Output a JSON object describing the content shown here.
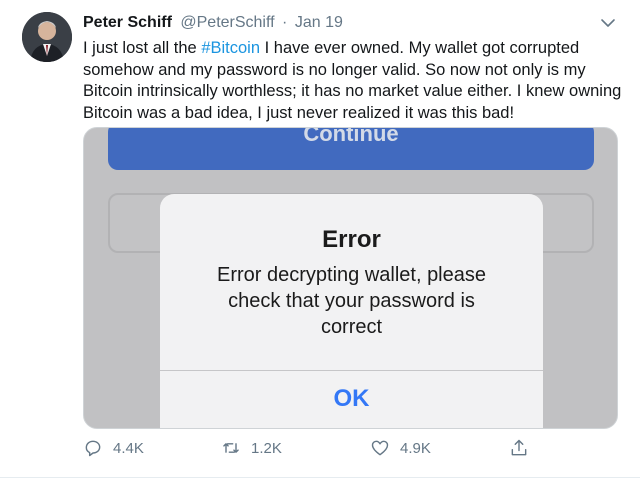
{
  "author": {
    "name": "Peter Schiff",
    "handle": "@PeterSchiff",
    "separator": "·",
    "date": "Jan 19"
  },
  "tweet": {
    "line1_before": "I just lost all the ",
    "hashtag": "#Bitcoin",
    "line1_after": " I have ever owned. My wallet got corrupted",
    "line2": "somehow and my password is no longer valid. So now not only is my",
    "line3": "Bitcoin intrinsically worthless; it has no market value either. I knew owning",
    "line4": "Bitcoin was a bad idea, I just never realized it was this bad!"
  },
  "media": {
    "continue_label": "Continue",
    "alert": {
      "title": "Error",
      "message_line1": "Error decrypting wallet, please",
      "message_line2": "check that your password is",
      "message_line3": "correct",
      "ok_label": "OK"
    }
  },
  "actions": {
    "reply_count": "4.4K",
    "retweet_count": "1.2K",
    "like_count": "4.9K"
  },
  "icons": {
    "caret": "chevron-down-icon",
    "reply": "reply-icon",
    "retweet": "retweet-icon",
    "like": "heart-icon",
    "share": "share-icon"
  },
  "colors": {
    "hashtag": "#1b95e0",
    "continue_button": "#2d5fc6",
    "ok_button_text": "#3478f6",
    "muted_text": "#657786"
  }
}
